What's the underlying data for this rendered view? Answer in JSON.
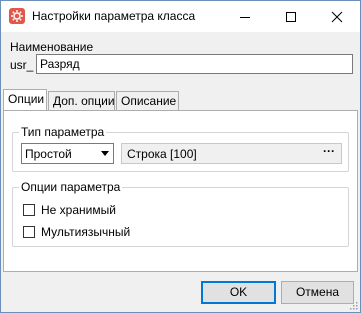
{
  "window": {
    "title": "Настройки параметра класса"
  },
  "name_section": {
    "label": "Наименование",
    "prefix": "usr_",
    "value": "Разряд"
  },
  "tabs": [
    {
      "label": "Опции",
      "active": true
    },
    {
      "label": "Доп. опции",
      "active": false
    },
    {
      "label": "Описание",
      "active": false
    }
  ],
  "param_type": {
    "group_title": "Тип параметра",
    "kind_selected": "Простой",
    "type_value": "Строка [100]",
    "browse_label": "···"
  },
  "param_options": {
    "group_title": "Опции параметра",
    "not_stored": {
      "label": "Не хранимый",
      "checked": false
    },
    "multilingual": {
      "label": "Мультиязычный",
      "checked": false
    }
  },
  "buttons": {
    "ok": "OK",
    "cancel": "Отмена"
  },
  "icons": [
    "app-icon",
    "minimize-icon",
    "maximize-icon",
    "close-icon",
    "dropdown-arrow-icon",
    "size-grip-icon"
  ],
  "colors": {
    "accent": "#0078d7",
    "titlebar": "#ffffff",
    "panel": "#ffffff",
    "app_icon": "#e0584a"
  }
}
